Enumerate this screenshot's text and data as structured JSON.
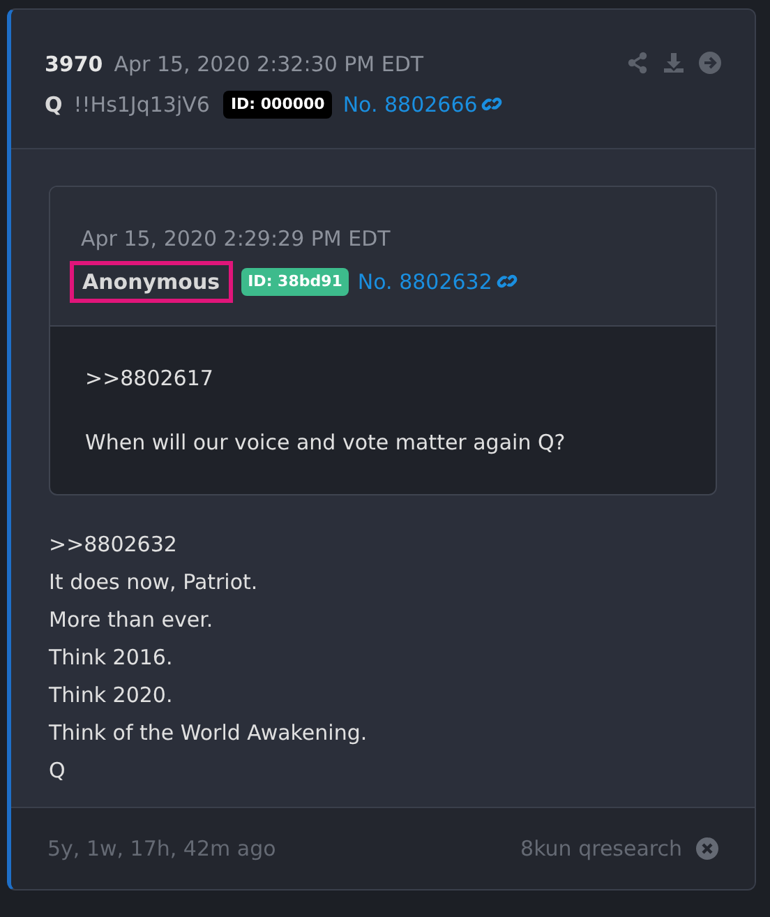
{
  "post": {
    "number": "3970",
    "timestamp": "Apr 15, 2020 2:32:30 PM EDT",
    "author": "Q",
    "tripcode": "!!Hs1Jq13jV6",
    "id_badge": {
      "text": "ID: 000000",
      "color": "#000000"
    },
    "post_no": "No. 8802666"
  },
  "quoted_post": {
    "timestamp": "Apr 15, 2020 2:29:29 PM EDT",
    "author": "Anonymous",
    "author_highlighted": true,
    "id_badge": {
      "text": "ID: 38bd91",
      "color": "#3dbb8c"
    },
    "post_no": "No. 8802632",
    "lines": [
      ">>8802617",
      "When will our voice and vote matter again Q?"
    ]
  },
  "body_lines": [
    ">>8802632",
    "It does now, Patriot.",
    "More than ever.",
    "Think 2016.",
    "Think 2020.",
    "Think of the World Awakening.",
    "Q"
  ],
  "footer": {
    "age": "5y, 1w, 17h, 42m ago",
    "source": "8kun qresearch"
  }
}
